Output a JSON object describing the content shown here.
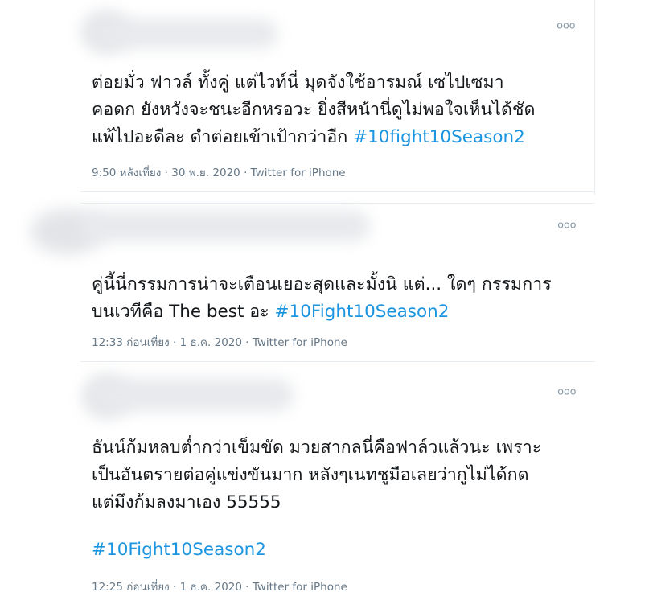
{
  "tweets": [
    {
      "more_label": "ooo",
      "lines": [
        "ต่อยมั่ว ฟาวล์ ทั้งคู่ แต่ไวท์นี่ มุดจังใช้อารมณ์ เซไปเซมา",
        "คอดก ยังหวังจะชนะอีกหรอวะ ยิ่งสีหน้านี่ดูไม่พอใจเห็นได้ชัด",
        "แพ้ไปอะดีละ ดำต่อยเข้าเป้ากว่าอีก "
      ],
      "hashtag": "#10fight10Season2",
      "time": "9:50 หลังเที่ยง",
      "date": "30 พ.ย. 2020",
      "source": "Twitter for iPhone"
    },
    {
      "more_label": "ooo",
      "lines": [
        "คู่นี้นี่กรรมการน่าจะเตือนเยอะสุดและมั้งนิ แต่... ใดๆ กรรมการ",
        "บนเวทีคือ The best อะ "
      ],
      "hashtag": "#10Fight10Season2",
      "time": "12:33 ก่อนเที่ยง",
      "date": "1 ธ.ค. 2020",
      "source": "Twitter for iPhone"
    },
    {
      "more_label": "ooo",
      "lines": [
        "ธันน์ก้มหลบต่ำกว่าเข็มขัด มวยสากลนี่คือฟาล์วแล้วนะ เพราะ",
        "เป็นอันตรายต่อคู่แข่งขันมาก หลังๆเนทชูมือเลยว่ากูไม่ได้กด",
        "แต่มึงก้มลงมาเอง 55555"
      ],
      "hashtag": "#10Fight10Season2",
      "time": "12:25 ก่อนเที่ยง",
      "date": "1 ธ.ค. 2020",
      "source": "Twitter for iPhone"
    }
  ],
  "separator": " · ",
  "colors": {
    "text": "#14171a",
    "hashtag": "#1b95e0",
    "meta": "#657786",
    "border": "#e6ecf0"
  }
}
